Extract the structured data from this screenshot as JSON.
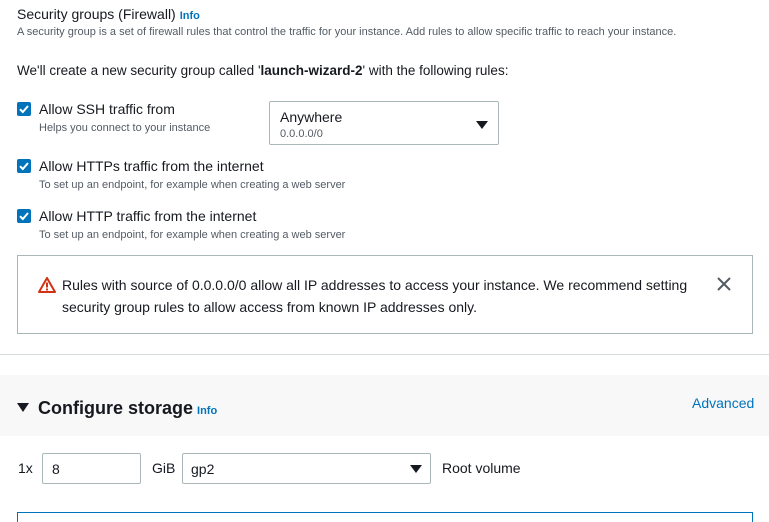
{
  "security_groups": {
    "title": "Security groups (Firewall)",
    "info_label": "Info",
    "description": "A security group is a set of firewall rules that control the traffic for your instance. Add rules to allow specific traffic to reach your instance.",
    "create_prefix": "We'll create a new security group called '",
    "group_name": "launch-wizard-2",
    "create_suffix": "' with the following rules:",
    "rules": [
      {
        "label": "Allow SSH traffic from",
        "help": "Helps you connect to your instance",
        "checked": true
      },
      {
        "label": "Allow HTTPs traffic from the internet",
        "help": "To set up an endpoint, for example when creating a web server",
        "checked": true
      },
      {
        "label": "Allow HTTP traffic from the internet",
        "help": "To set up an endpoint, for example when creating a web server",
        "checked": true
      }
    ],
    "ssh_source": {
      "value": "Anywhere",
      "sub": "0.0.0.0/0"
    },
    "warning": "Rules with source of 0.0.0.0/0 allow all IP addresses to access your instance. We recommend setting security group rules to allow access from known IP addresses only."
  },
  "storage": {
    "title": "Configure storage",
    "info_label": "Info",
    "advanced_label": "Advanced",
    "multiplier": "1x",
    "size": "8",
    "unit": "GiB",
    "volume_type": "gp2",
    "volume_label": "Root volume"
  },
  "colors": {
    "accent": "#0073bb",
    "warning": "#d13212"
  }
}
